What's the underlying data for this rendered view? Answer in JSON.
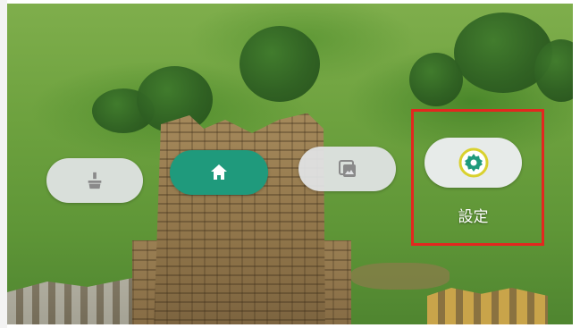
{
  "background": {
    "scene": "aerial-view-ruined-stone-tower-in-green-field"
  },
  "nav": {
    "buttons": [
      {
        "id": "clean",
        "icon": "broom-icon",
        "active": false
      },
      {
        "id": "home",
        "icon": "home-icon",
        "active": true
      },
      {
        "id": "gallery",
        "icon": "gallery-icon",
        "active": false
      },
      {
        "id": "settings",
        "icon": "settings-gear-icon",
        "active": false,
        "label": "設定",
        "highlighted": true
      }
    ]
  },
  "colors": {
    "active_button": "#1f9a7c",
    "inactive_button": "#e2e4e6",
    "highlight_border": "#e3271f",
    "settings_gear_outer": "#d9d12e",
    "settings_gear_inner": "#1f9a7c"
  }
}
